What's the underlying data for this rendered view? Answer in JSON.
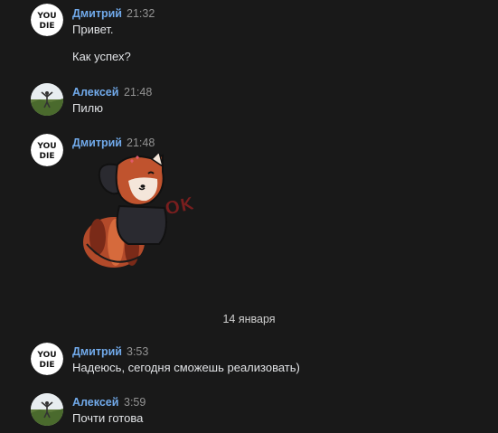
{
  "messages": [
    {
      "author": "Дмитрий",
      "time": "21:32",
      "lines": [
        "Привет.",
        "Как успех?"
      ]
    },
    {
      "author": "Алексей",
      "time": "21:48",
      "lines": [
        "Пилю"
      ]
    },
    {
      "author": "Дмитрий",
      "time": "21:48",
      "sticker": "red-panda-ok-sticker",
      "sticker_text": "OK"
    },
    {
      "author": "Дмитрий",
      "time": "3:53",
      "lines": [
        "Надеюсь, сегодня сможешь реализовать)"
      ]
    },
    {
      "author": "Алексей",
      "time": "3:59",
      "lines": [
        "Почти готова"
      ]
    }
  ],
  "date_separator": "14 января",
  "avatar_dmitry": {
    "text_top": "YOU",
    "text_bottom": "DIE"
  },
  "colors": {
    "background": "#191919",
    "author_name": "#71aaeb",
    "time": "#939393",
    "text": "#e1e3e6"
  }
}
